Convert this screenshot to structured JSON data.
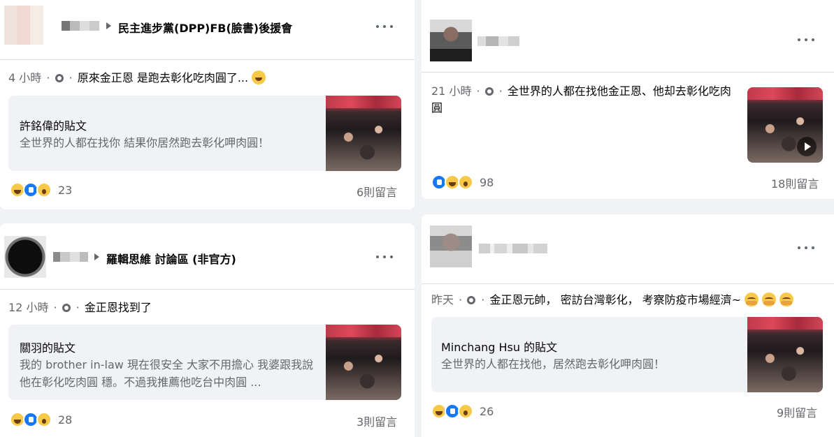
{
  "posts": [
    {
      "group": "民主進步黨(DPP)FB(臉書)後援會",
      "time": "4 小時",
      "text": "原來金正恩 是跑去彰化吃肉圓了...",
      "share_title": "許銘偉的貼文",
      "share_desc": "全世界的人都在找你 結果你居然跑去彰化呷肉圓！",
      "reaction_count": "23",
      "comments": "6則留言"
    },
    {
      "group": "羅輯思維 討論區 (非官方)",
      "time": "12 小時",
      "text": "金正恩找到了",
      "share_title": "關羽的貼文",
      "share_desc": "我的 brother in-law 現在很安全 大家不用擔心 我婆跟我說他在彰化吃肉圓 穩。不過我推薦他吃台中肉圓 ...",
      "reaction_count": "28",
      "comments": "3則留言"
    },
    {
      "time": "21 小時",
      "text": "全世界的人都在找他金正恩、他却去彰化吃肉圓",
      "reaction_count": "98",
      "comments": "18則留言"
    },
    {
      "time": "昨天",
      "text": "金正恩元帥， 密訪台灣彰化， 考察防疫市場經濟~",
      "share_title": "Minchang Hsu 的貼文",
      "share_desc": "全世界的人都在找他，居然跑去彰化呷肉圓！",
      "reaction_count": "26",
      "comments": "9則留言"
    }
  ],
  "separator": "·"
}
